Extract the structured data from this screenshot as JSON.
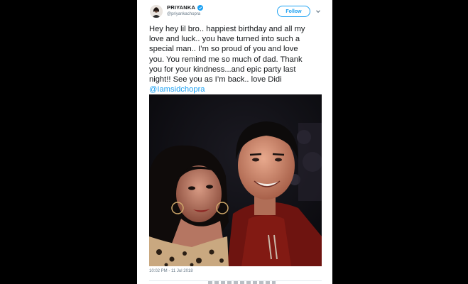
{
  "tweet": {
    "display_name": "PRIYANKA",
    "handle": "@priyankachopra",
    "follow_label": "Follow",
    "text_lines": [
      "Hey hey lil bro.. happiest birthday and all my",
      "love and luck.. you have turned into such a",
      "special man.. I’m so proud of you and love",
      "you. You remind me so much of dad. Thank",
      "you for your kindness...and epic party last",
      "night!! See you as I’m back.. love Didi"
    ],
    "mention": "@Iamsidchopra",
    "timestamp": "10:02 PM - 11 Jul 2018"
  },
  "colors": {
    "accent": "#1da1f2",
    "text": "#14171a",
    "muted": "#657786"
  },
  "icons": {
    "verified": "verified-badge-icon",
    "menu": "chevron-down-icon"
  }
}
